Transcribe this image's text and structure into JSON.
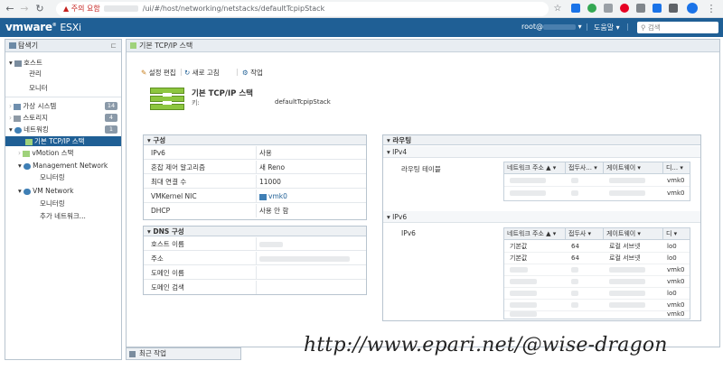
{
  "browser": {
    "security_label": "주의 요함",
    "url_path": "/ui/#/host/networking/netstacks/defaultTcpipStack"
  },
  "header": {
    "brand": "vmware",
    "product": "ESXi",
    "user": "root@",
    "help": "도움말",
    "search_placeholder": "검색"
  },
  "navigator": {
    "title": "탐색기",
    "items": [
      {
        "label": "호스트"
      },
      {
        "label": "관리"
      },
      {
        "label": "모니터"
      },
      {
        "label": "가상 시스템",
        "badge": "14"
      },
      {
        "label": "스토리지",
        "badge": "4"
      },
      {
        "label": "네트워킹",
        "badge": "1"
      },
      {
        "label": "기본 TCP/IP 스택"
      },
      {
        "label": "vMotion 스택"
      },
      {
        "label": "Management Network"
      },
      {
        "label": "모니터링"
      },
      {
        "label": "VM Network"
      },
      {
        "label": "모니터링"
      },
      {
        "label": "추가 네트워크..."
      }
    ]
  },
  "main": {
    "tab_title": "기본 TCP/IP 스택",
    "toolbar": {
      "edit": "설정 편집",
      "refresh": "새로 고침",
      "actions": "작업"
    },
    "stack_title": "기본 TCP/IP 스택",
    "key_label": "키:",
    "key_value": "defaultTcpipStack",
    "config": {
      "title": "구성",
      "rows": [
        {
          "k": "IPv6",
          "v": "사용"
        },
        {
          "k": "혼잡 제어 알고리즘",
          "v": "새 Reno"
        },
        {
          "k": "최대 연결 수",
          "v": "11000"
        },
        {
          "k": "VMKernel NIC",
          "v": "vmk0"
        },
        {
          "k": "DHCP",
          "v": "사용 안 함"
        }
      ]
    },
    "dns": {
      "title": "DNS 구성",
      "rows": [
        {
          "k": "호스트 이름"
        },
        {
          "k": "주소"
        },
        {
          "k": "도메인 이름"
        },
        {
          "k": "도메인 검색"
        }
      ]
    },
    "routing": {
      "title": "라우팅",
      "ipv4": {
        "title": "IPv4",
        "table_label": "라우팅 테이블",
        "cols": [
          "네트워크 주소 ▲",
          "접두사...",
          "게이트웨이",
          "디..."
        ],
        "rows": [
          {
            "dev": "vmk0"
          },
          {
            "dev": "vmk0"
          }
        ]
      },
      "ipv6": {
        "title": "IPv6",
        "table_label": "IPv6",
        "cols": [
          "네트워크 주소 ▲",
          "접두사",
          "게이트웨이",
          "디"
        ],
        "rows": [
          {
            "net": "기본값",
            "prefix": "64",
            "gw": "로컬 서브넷",
            "dev": "lo0"
          },
          {
            "net": "기본값",
            "prefix": "64",
            "gw": "로컬 서브넷",
            "dev": "lo0"
          },
          {
            "net": "",
            "prefix": "",
            "gw": "",
            "dev": "vmk0"
          },
          {
            "net": "",
            "prefix": "",
            "gw": "",
            "dev": "vmk0"
          },
          {
            "net": "",
            "prefix": "",
            "gw": "",
            "dev": "lo0"
          },
          {
            "net": "",
            "prefix": "",
            "gw": "",
            "dev": "vmk0"
          },
          {
            "net": "",
            "prefix": "",
            "gw": "",
            "dev": "vmk0"
          }
        ]
      }
    }
  },
  "recent_tasks": "최근 작업",
  "watermark": "http://www.epari.net/@wise-dragon"
}
